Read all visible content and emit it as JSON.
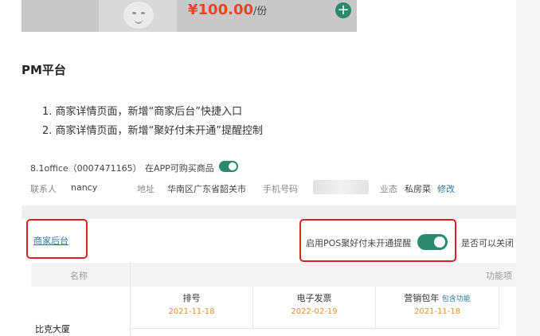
{
  "product": {
    "currency": "¥",
    "price": "100.00",
    "unit": "/份",
    "add_label": "+"
  },
  "section_title": "PM平台",
  "requirements": [
    "1. 商家详情页面，新增“商家后台”快捷入口",
    "2. 商家详情页面，新增“聚好付未开通”提醒控制"
  ],
  "merchant": {
    "id_line": "8.1office（0007471165）",
    "app_purchase_label": "在APP可购买商品",
    "app_purchase_enabled": true,
    "contact_label": "联系人",
    "contact_value": "nancy",
    "address_label": "地址",
    "address_value": "华南区广东省韶关市",
    "phone_label": "手机号码",
    "business_label": "业态",
    "business_value": "私房菜",
    "edit_label": "修改"
  },
  "backend_link": "商家后台",
  "pos_reminder": {
    "label": "启用POS聚好付未开通提醒",
    "enabled": true
  },
  "close_label": "是否可以关闭",
  "table": {
    "name_header": "名称",
    "function_header": "功能项",
    "row_name": "比克大厦",
    "columns": [
      {
        "title": "排号",
        "extra": "",
        "date": "2021-11-18"
      },
      {
        "title": "电子发票",
        "extra": "",
        "date": "2022-02-19"
      },
      {
        "title": "营销包年",
        "extra": "包含功能",
        "date": "2021-11-18"
      }
    ]
  },
  "colors": {
    "accent_green": "#2b8a6e",
    "price_red": "#e8442a",
    "highlight_red": "#e02020",
    "date_orange": "#e8902a",
    "link_blue": "#2b7a9a"
  }
}
